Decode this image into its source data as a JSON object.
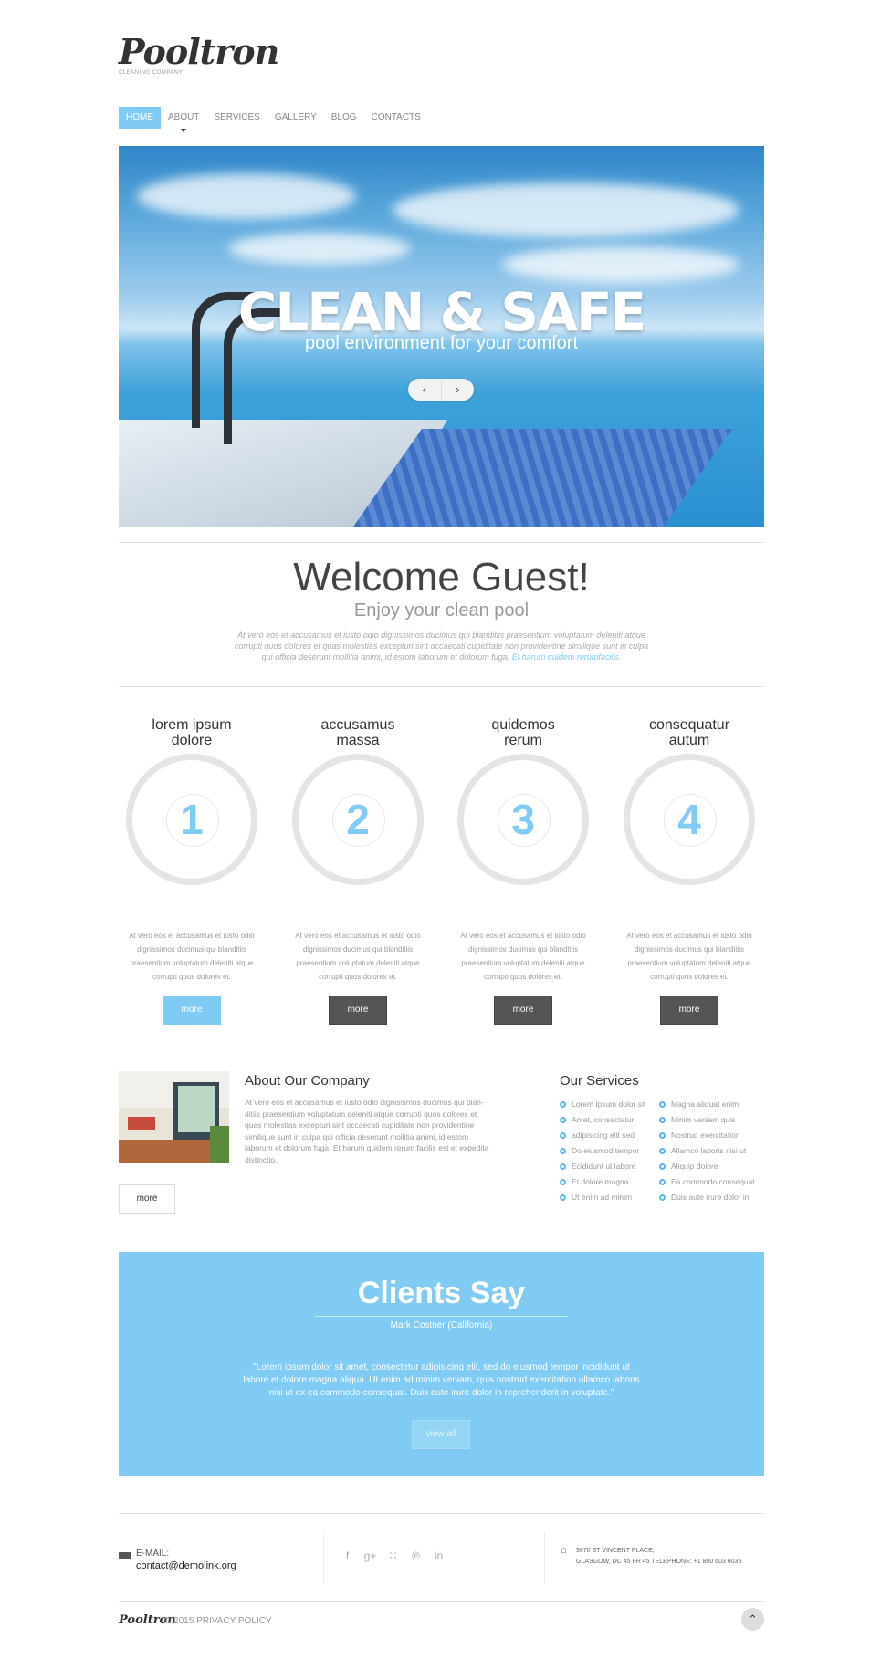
{
  "header": {
    "logo": "Pooltron",
    "tagline": "CLEANING COMPANY"
  },
  "nav": {
    "items": [
      {
        "label": "HOME",
        "active": true
      },
      {
        "label": "ABOUT",
        "active": false
      },
      {
        "label": "SERVICES",
        "active": false
      },
      {
        "label": "GALLERY",
        "active": false
      },
      {
        "label": "BLOG",
        "active": false
      },
      {
        "label": "CONTACTS",
        "active": false
      }
    ]
  },
  "hero": {
    "title": "CLEAN & SAFE",
    "subtitle": "pool environment for your comfort",
    "prev_icon": "‹",
    "next_icon": "›"
  },
  "welcome": {
    "title": "Welcome Guest!",
    "subtitle": "Enjoy your clean pool",
    "text": "At vero eos et accusamus et iusto odio dignissimos ducimus qui blanditiis praesentium voluptatum deleniti atque corrupti quos dolores et quas molestias excepturi sint occaecati cupiditate non providentine similique sunt in culpa qui officia deserunt mollitia animi, id estom laborum et dolorum fuga.",
    "link": "Et harum quidem rerumfacilis."
  },
  "features": [
    {
      "title_1": "lorem ipsum",
      "title_2": "dolore",
      "number": "1",
      "text": "At vero eos et accusamus et iusto odio dignissimos ducimus qui blanditiis praesentium voluptatum deleniti atque corrupti quos dolores et.",
      "button": "more"
    },
    {
      "title_1": "accusamus",
      "title_2": "massa",
      "number": "2",
      "text": "At vero eos et accusamus et iusto odio dignissimos ducimus qui blanditiis praesentium voluptatum deleniti atque corrupti quos dolores et.",
      "button": "more"
    },
    {
      "title_1": "quidemos",
      "title_2": "rerum",
      "number": "3",
      "text": "At vero eos et accusamus et iusto odio dignissimos ducimus qui blanditiis praesentium voluptatum deleniti atque corrupti quos dolores et.",
      "button": "more"
    },
    {
      "title_1": "consequatur",
      "title_2": "autum",
      "number": "4",
      "text": "At vero eos et accusamus et iusto odio dignissimos ducimus qui blanditiis praesentium voluptatum deleniti atque corrupti quos dolores et.",
      "button": "more"
    }
  ],
  "about": {
    "title": "About Our Company",
    "text": "At vero eos et accusamus et iusto odio dignissimos ducimus qui blan-ditiis praesentium voluptatum deleniti atque corrupti quos dolores et quas molestias excepturi sint occaecati cupiditate non providentine similique sunt in culpa qui officia deserunt mollitia animi, id estom laborum et dolorum fuga. Et harum quidem rerum facilis est et expedita distinctio.",
    "button": "more"
  },
  "services": {
    "title": "Our Services",
    "col1": [
      "Lorem ipsum dolor sit",
      "Amet, consectetur",
      "adipisicing elit sed",
      "Do eiusmod tempor",
      "Ecididunt ut labore",
      "Et dolore magna",
      "Ut enim ad minim"
    ],
    "col2": [
      "Magna aliquat enim",
      "Minim veniam quis",
      "Nostrud exercitation",
      "Allamco laboris nisi ut",
      "Aliquip dolore",
      "Ea commodo consequat",
      "Duis aute irure dolor in"
    ]
  },
  "clients": {
    "title": "Clients Say",
    "author": "Mark Costner (California)",
    "quote": "\"Lorem ipsum dolor sit amet, consectetur adipisicing elit, sed do eiusmod tempor incididunt ut labore et dolore magna aliqua. Ut enim ad minim veniam, quis nostrud exercitation ullamco laboris nisi ut ex ea commodo consequat. Duis aute irure dolor in reprehenderit in voluptate.\"",
    "button": "view all"
  },
  "footer": {
    "email_label": "E-MAIL:",
    "email": "contact@demolink.org",
    "social_icons": [
      "facebook-icon",
      "google-plus-icon",
      "rss-icon",
      "pinterest-icon",
      "linkedin-icon"
    ],
    "address_line1": "9870 ST VINCENT PLACE,",
    "address_line2": "GLASGOW, DC 45 FR 45 TELEPHONE:  +1 800 603 6035",
    "logo": "Pooltron",
    "copyright": "© 2015 PRIVACY POLICY"
  },
  "colors": {
    "accent": "#7fcbf3",
    "dark_button": "#555555"
  }
}
